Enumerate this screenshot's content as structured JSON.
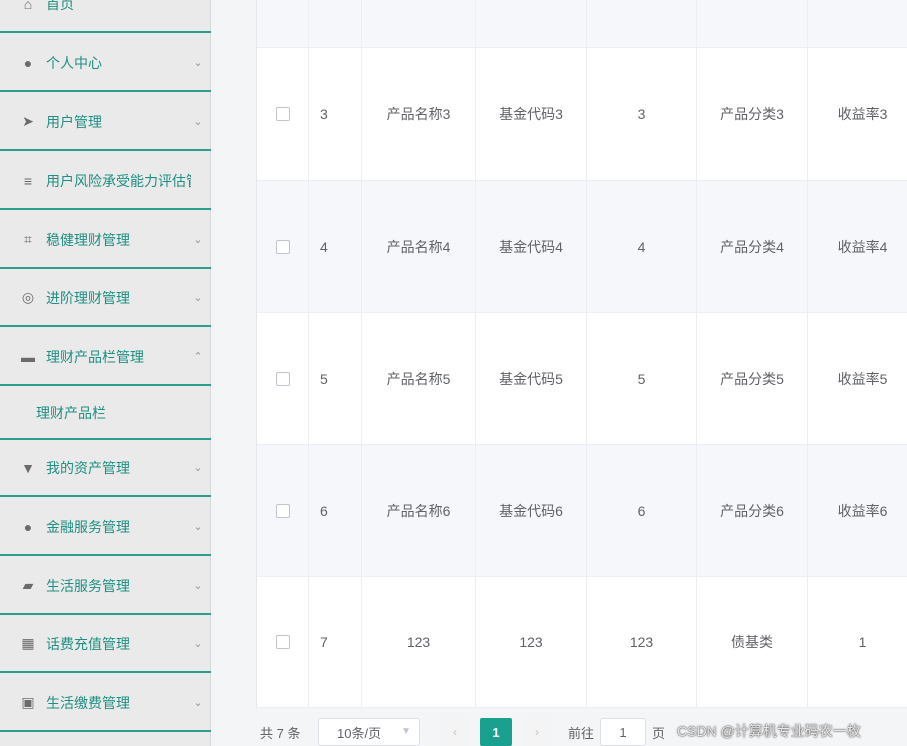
{
  "sidebar": {
    "items": [
      {
        "label": "首页",
        "icon": "home-icon",
        "glyph": "⌂",
        "arrow": ""
      },
      {
        "label": "个人中心",
        "icon": "user-icon",
        "glyph": "●",
        "arrow": "⌄"
      },
      {
        "label": "用户管理",
        "icon": "send-icon",
        "glyph": "➤",
        "arrow": "⌄"
      },
      {
        "label": "用户风险承受能力评估管理",
        "icon": "list-icon",
        "glyph": "≡",
        "arrow": ""
      },
      {
        "label": "稳健理财管理",
        "icon": "crop-icon",
        "glyph": "⌗",
        "arrow": "⌄"
      },
      {
        "label": "进阶理财管理",
        "icon": "gauge-icon",
        "glyph": "◎",
        "arrow": "⌄"
      },
      {
        "label": "理财产品栏管理",
        "icon": "briefcase-icon",
        "glyph": "▬",
        "arrow": "⌃"
      },
      {
        "label": "我的资产管理",
        "icon": "stamp-icon",
        "glyph": "▼",
        "arrow": "⌄"
      },
      {
        "label": "金融服务管理",
        "icon": "pin-icon",
        "glyph": "●",
        "arrow": "⌄"
      },
      {
        "label": "生活服务管理",
        "icon": "ticket-icon",
        "glyph": "▰",
        "arrow": "⌄"
      },
      {
        "label": "话费充值管理",
        "icon": "grid-icon",
        "glyph": "▦",
        "arrow": "⌄"
      },
      {
        "label": "生活缴费管理",
        "icon": "wallet-icon",
        "glyph": "▣",
        "arrow": "⌄"
      }
    ],
    "submenu": {
      "label": "理财产品栏"
    }
  },
  "table": {
    "rows": [
      {
        "idx": "",
        "name": "",
        "code": "",
        "num": "",
        "category": "",
        "rate": ""
      },
      {
        "idx": "3",
        "name": "产品名称3",
        "code": "基金代码3",
        "num": "3",
        "category": "产品分类3",
        "rate": "收益率3"
      },
      {
        "idx": "4",
        "name": "产品名称4",
        "code": "基金代码4",
        "num": "4",
        "category": "产品分类4",
        "rate": "收益率4"
      },
      {
        "idx": "5",
        "name": "产品名称5",
        "code": "基金代码5",
        "num": "5",
        "category": "产品分类5",
        "rate": "收益率5"
      },
      {
        "idx": "6",
        "name": "产品名称6",
        "code": "基金代码6",
        "num": "6",
        "category": "产品分类6",
        "rate": "收益率6"
      },
      {
        "idx": "7",
        "name": "123",
        "code": "123",
        "num": "123",
        "category": "债基类",
        "rate": "1"
      }
    ]
  },
  "pagination": {
    "total": "共 7 条",
    "page_size": "10条/页",
    "current": "1",
    "goto_label": "前往",
    "goto_value": "1",
    "page_suffix": "页"
  },
  "watermark": "CSDN @计算机专业码农一枚",
  "colors": {
    "accent": "#1aa08f",
    "menu_text": "#1f8f83",
    "menu_border": "#2a9d8f"
  }
}
